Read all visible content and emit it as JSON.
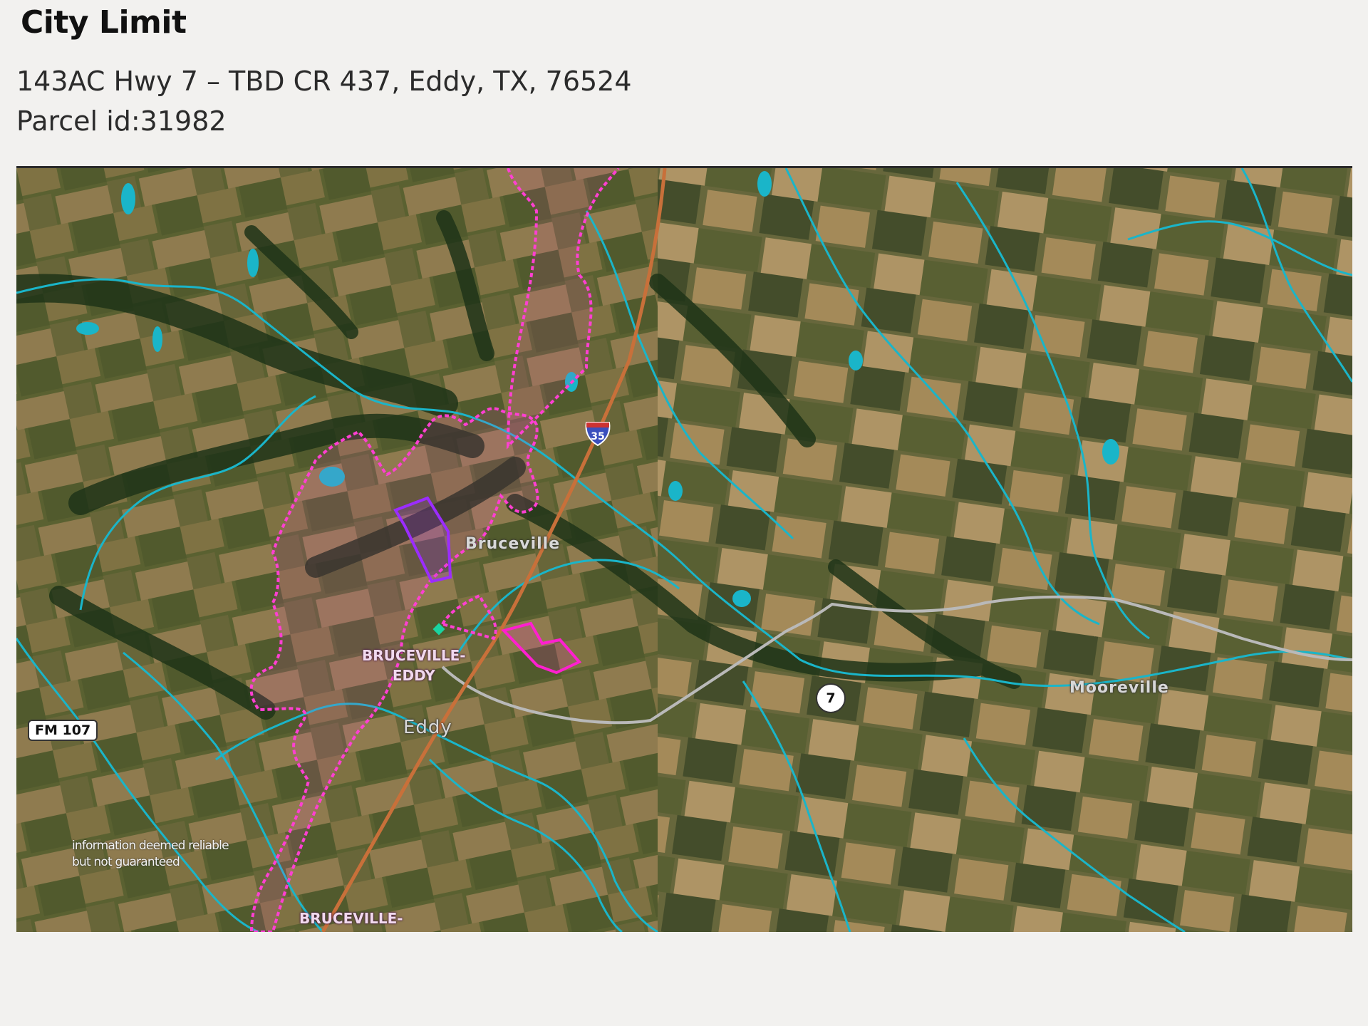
{
  "title": "City Limit",
  "address": "143AC Hwy 7 – TBD CR 437, Eddy, TX, 76524",
  "parcel": "Parcel id:31982",
  "map": {
    "type": "satellite",
    "disclaimer_line1": "information deemed reliable",
    "disclaimer_line2": "but not guaranteed",
    "labels": {
      "bruceville": "Bruceville",
      "eddy": "Eddy",
      "mooreville": "Mooreville",
      "city_limit_line1": "BRUCEVILLE-",
      "city_limit_line2": "EDDY",
      "city_limit_bottom": "BRUCEVILLE-"
    },
    "shields": {
      "interstate": "35",
      "state_highway": "7",
      "farm_road": "FM 107"
    },
    "colors": {
      "city_limit": "#ff3fd2",
      "parcel": "#9b2cff",
      "parcel_secondary": "#ff1fd0",
      "water": "#1ab5c9",
      "road": "#c9c9c9",
      "interstate": "#c8703a"
    }
  }
}
